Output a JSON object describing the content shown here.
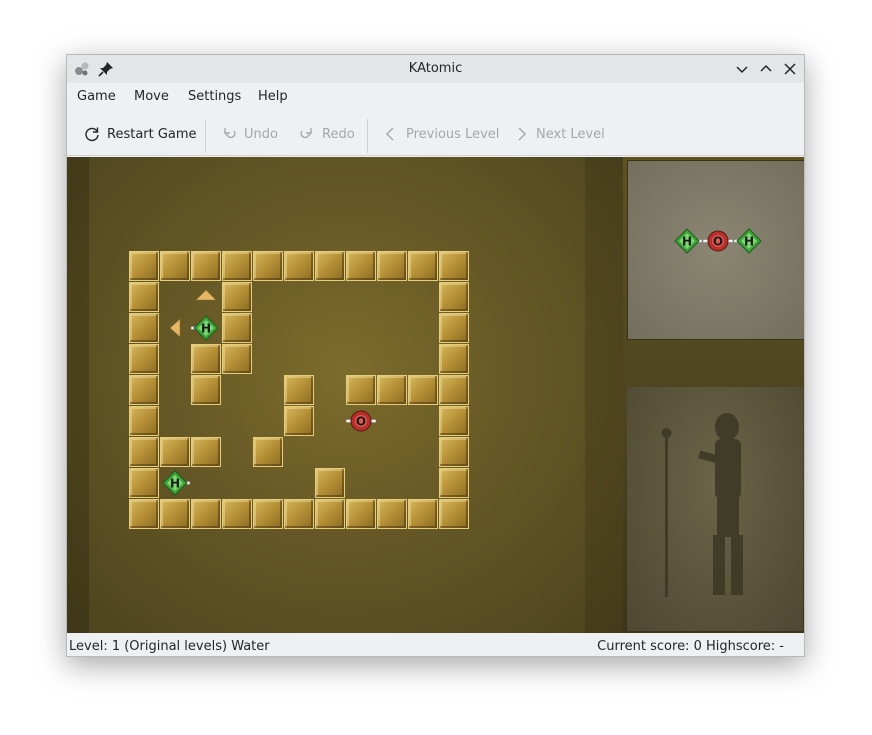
{
  "window": {
    "title": "KAtomic"
  },
  "menu": [
    "Game",
    "Move",
    "Settings",
    "Help"
  ],
  "toolbar": {
    "restart": "Restart Game",
    "undo": "Undo",
    "redo": "Redo",
    "previous": "Previous Level",
    "next": "Next Level"
  },
  "status": {
    "level": "Level: 1 (Original levels)  Water",
    "score": "Current score: 0  Highscore: -"
  },
  "colors": {
    "wall": "#c8a548",
    "hydrogen": "#3fa33a",
    "oxygen": "#b7302c"
  },
  "board": {
    "cols": 11,
    "rows": 9,
    "walls": [
      [
        0,
        0
      ],
      [
        1,
        0
      ],
      [
        2,
        0
      ],
      [
        3,
        0
      ],
      [
        4,
        0
      ],
      [
        5,
        0
      ],
      [
        6,
        0
      ],
      [
        7,
        0
      ],
      [
        8,
        0
      ],
      [
        9,
        0
      ],
      [
        10,
        0
      ],
      [
        0,
        1
      ],
      [
        3,
        1
      ],
      [
        10,
        1
      ],
      [
        0,
        2
      ],
      [
        3,
        2
      ],
      [
        10,
        2
      ],
      [
        0,
        3
      ],
      [
        2,
        3
      ],
      [
        3,
        3
      ],
      [
        10,
        3
      ],
      [
        0,
        4
      ],
      [
        2,
        4
      ],
      [
        5,
        4
      ],
      [
        7,
        4
      ],
      [
        8,
        4
      ],
      [
        9,
        4
      ],
      [
        10,
        4
      ],
      [
        0,
        5
      ],
      [
        5,
        5
      ],
      [
        10,
        5
      ],
      [
        0,
        6
      ],
      [
        1,
        6
      ],
      [
        2,
        6
      ],
      [
        4,
        6
      ],
      [
        10,
        6
      ],
      [
        0,
        7
      ],
      [
        6,
        7
      ],
      [
        10,
        7
      ],
      [
        0,
        8
      ],
      [
        1,
        8
      ],
      [
        2,
        8
      ],
      [
        3,
        8
      ],
      [
        4,
        8
      ],
      [
        5,
        8
      ],
      [
        6,
        8
      ],
      [
        7,
        8
      ],
      [
        8,
        8
      ],
      [
        9,
        8
      ],
      [
        10,
        8
      ]
    ],
    "atoms": [
      {
        "element": "H",
        "col": 2,
        "row": 2,
        "bonds": [
          "left"
        ],
        "selected": true
      },
      {
        "element": "O",
        "col": 7,
        "row": 5,
        "bonds": [
          "left",
          "right"
        ],
        "selected": false
      },
      {
        "element": "H",
        "col": 1,
        "row": 7,
        "bonds": [
          "right"
        ],
        "selected": false
      }
    ],
    "arrows": [
      {
        "direction": "up",
        "col": 2,
        "row": 1
      },
      {
        "direction": "left",
        "col": 1,
        "row": 2
      }
    ]
  },
  "target_molecule": [
    {
      "element": "H",
      "bonds": [
        "right"
      ]
    },
    {
      "element": "O",
      "bonds": [
        "left",
        "right"
      ]
    },
    {
      "element": "H",
      "bonds": [
        "left"
      ]
    }
  ]
}
